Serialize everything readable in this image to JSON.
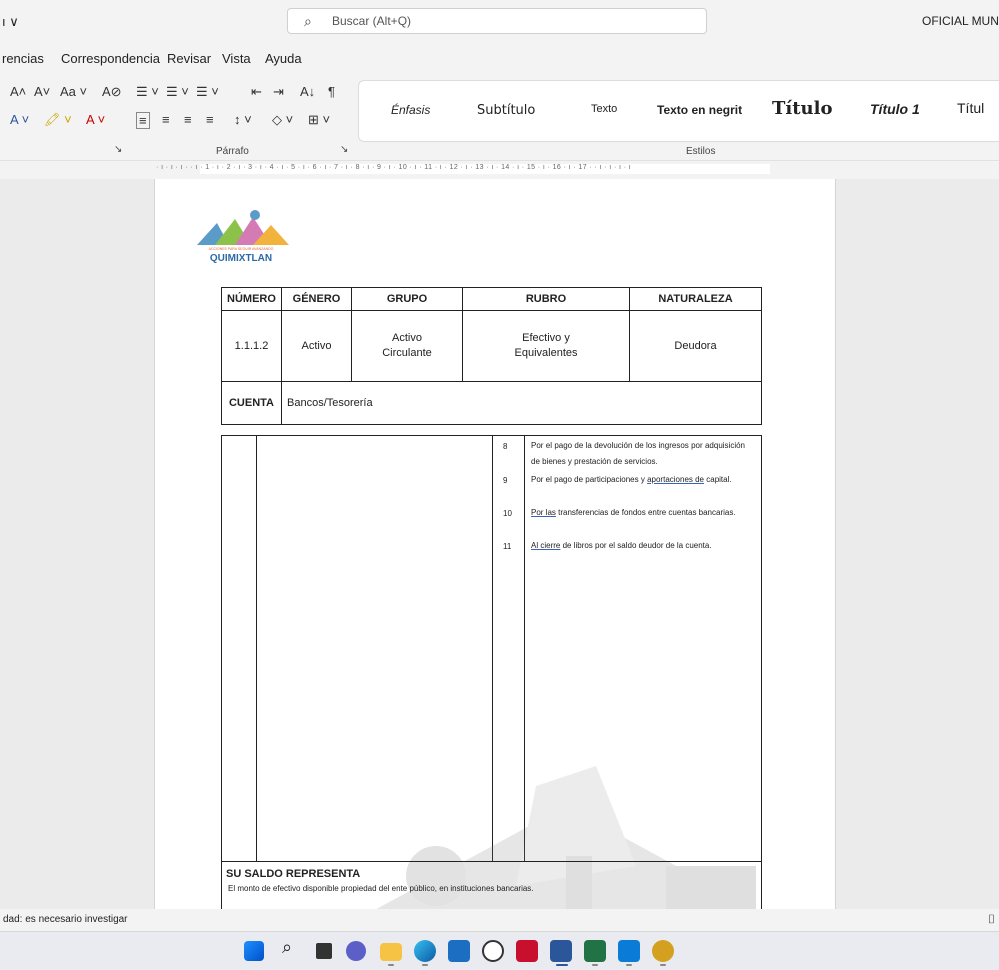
{
  "titlebar": {
    "left_fragment": "ı ∨",
    "search_placeholder": "Buscar (Alt+Q)",
    "right_fragment": "OFICIAL MUNIC"
  },
  "menu": [
    "rencias",
    "Correspondencia",
    "Revisar",
    "Vista",
    "Ayuda"
  ],
  "ribbon": {
    "row1": [
      "A˄",
      "A˅",
      "Aa ˅",
      "A⊘",
      "☰ ˅",
      "☰ ˅",
      "☰ ˅",
      "⇤",
      "⇥",
      "A↓",
      "¶"
    ],
    "row2": [
      "A ˅",
      "🖍 ˅",
      "A ˅",
      "≡",
      "≡",
      "≡",
      "≡",
      "↕ ˅",
      "◇ ˅",
      "⊞ ˅"
    ],
    "paragraph_label": "Párrafo",
    "styles_label": "Estilos",
    "styles": [
      "Énfasis",
      "Subtítulo",
      "Texto",
      "Texto en negrit",
      "Título",
      "Título 1",
      "Títul"
    ]
  },
  "ruler_text": "· ı · ı · ı ·  · ı · 1 · ı · 2 · ı · 3 · ı · 4 · ı · 5 · ı · 6 · ı · 7 · ı · 8 · ı · 9 · ı · 10 · ı · 11 · ı · 12 · ı · 13 · ı · 14 · ı · 15 · ı · 16 · ı · 17 ·  · ı · ı · ı · ı",
  "document": {
    "logo_tagline": "ACCIONES PARA SEGUIR AVANZANDO",
    "logo_name": "QUIMIXTLAN",
    "table": {
      "headers": [
        "NÚMERO",
        "GÉNERO",
        "GRUPO",
        "RUBRO",
        "NATURALEZA"
      ],
      "row": [
        "1.1.1.2",
        "Activo",
        "Activo Circulante",
        "Efectivo y Equivalentes",
        "Deudora"
      ],
      "cuenta_label": "CUENTA",
      "cuenta_value": "Bancos/Tesorería"
    },
    "items": [
      {
        "num": "8",
        "text": "Por el pago de la devolución de los ingresos  por adquisición de bienes y prestación de servicios."
      },
      {
        "num": "9",
        "pre": "Por el pago de participaciones y ",
        "u": "aportaciones de",
        "post": " capital."
      },
      {
        "num": "10",
        "u": "Por las",
        "post": " transferencias de fondos entre cuentas bancarias."
      },
      {
        "num": "11",
        "u": "Al cierre",
        "post": " de libros por el saldo deudor de  la cuenta."
      }
    ],
    "saldo_heading": "SU SALDO REPRESENTA",
    "saldo_text": "El monto de efectivo disponible propiedad del ente público, en instituciones bancarias."
  },
  "status": "dad: es necesario investigar",
  "colors": {
    "word_blue": "#2b579a",
    "logo_blue": "#2d6aa3"
  },
  "taskbar_icons": [
    "windows-start-icon",
    "search-icon",
    "task-view-icon",
    "chat-icon",
    "file-explorer-icon",
    "edge-icon",
    "store-icon",
    "dell-icon",
    "mcafee-icon",
    "word-icon",
    "excel-icon",
    "movies-icon",
    "app-icon"
  ]
}
